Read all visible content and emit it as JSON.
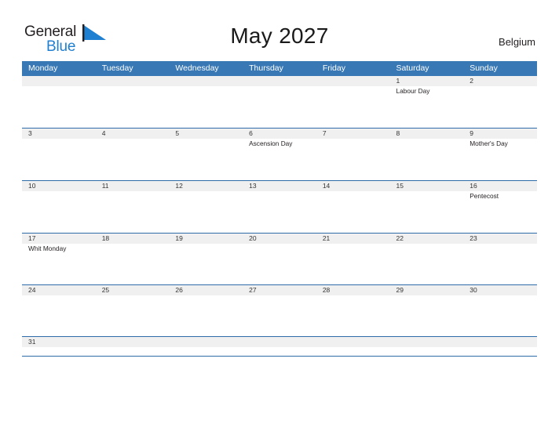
{
  "brand": {
    "word_one": "General",
    "word_two": "Blue",
    "flag_icon": "blue-flag-triangle-icon",
    "accent_color": "#1f7fd0"
  },
  "header": {
    "title": "May 2027",
    "region": "Belgium"
  },
  "theme": {
    "header_blue": "#3878b5",
    "rule_blue": "#2d6ca8",
    "date_band_gray": "#f0f0f0",
    "text_dark": "#231f20"
  },
  "calendar": {
    "day_headers": [
      "Monday",
      "Tuesday",
      "Wednesday",
      "Thursday",
      "Friday",
      "Saturday",
      "Sunday"
    ],
    "weeks": [
      {
        "days": [
          {
            "number": "",
            "event": ""
          },
          {
            "number": "",
            "event": ""
          },
          {
            "number": "",
            "event": ""
          },
          {
            "number": "",
            "event": ""
          },
          {
            "number": "",
            "event": ""
          },
          {
            "number": "1",
            "event": "Labour Day"
          },
          {
            "number": "2",
            "event": ""
          }
        ]
      },
      {
        "days": [
          {
            "number": "3",
            "event": ""
          },
          {
            "number": "4",
            "event": ""
          },
          {
            "number": "5",
            "event": ""
          },
          {
            "number": "6",
            "event": "Ascension Day"
          },
          {
            "number": "7",
            "event": ""
          },
          {
            "number": "8",
            "event": ""
          },
          {
            "number": "9",
            "event": "Mother's Day"
          }
        ]
      },
      {
        "days": [
          {
            "number": "10",
            "event": ""
          },
          {
            "number": "11",
            "event": ""
          },
          {
            "number": "12",
            "event": ""
          },
          {
            "number": "13",
            "event": ""
          },
          {
            "number": "14",
            "event": ""
          },
          {
            "number": "15",
            "event": ""
          },
          {
            "number": "16",
            "event": "Pentecost"
          }
        ]
      },
      {
        "days": [
          {
            "number": "17",
            "event": "Whit Monday"
          },
          {
            "number": "18",
            "event": ""
          },
          {
            "number": "19",
            "event": ""
          },
          {
            "number": "20",
            "event": ""
          },
          {
            "number": "21",
            "event": ""
          },
          {
            "number": "22",
            "event": ""
          },
          {
            "number": "23",
            "event": ""
          }
        ]
      },
      {
        "days": [
          {
            "number": "24",
            "event": ""
          },
          {
            "number": "25",
            "event": ""
          },
          {
            "number": "26",
            "event": ""
          },
          {
            "number": "27",
            "event": ""
          },
          {
            "number": "28",
            "event": ""
          },
          {
            "number": "29",
            "event": ""
          },
          {
            "number": "30",
            "event": ""
          }
        ]
      },
      {
        "days": [
          {
            "number": "31",
            "event": ""
          },
          {
            "number": "",
            "event": ""
          },
          {
            "number": "",
            "event": ""
          },
          {
            "number": "",
            "event": ""
          },
          {
            "number": "",
            "event": ""
          },
          {
            "number": "",
            "event": ""
          },
          {
            "number": "",
            "event": ""
          }
        ]
      }
    ]
  }
}
